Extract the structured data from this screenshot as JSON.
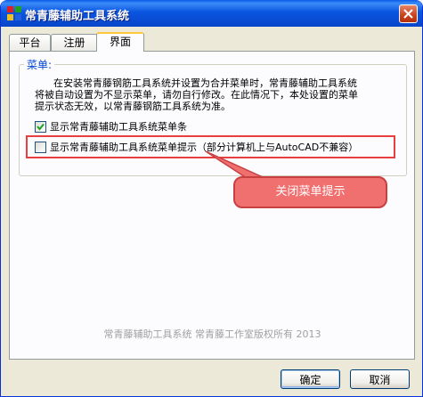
{
  "window": {
    "title": "常青藤辅助工具系统",
    "close_icon": "close-icon",
    "app_icon": "app-icon"
  },
  "tabs": [
    {
      "label": "平台",
      "active": false
    },
    {
      "label": "注册",
      "active": false
    },
    {
      "label": "界面",
      "active": true
    }
  ],
  "menu_group": {
    "legend": "菜单:",
    "description_lines": [
      "      在安装常青藤钢筋工具系统并设置为合并菜单时，常青藤辅助工具系统",
      "将被自动设置为不显示菜单，请勿自行修改。在此情况下，本处设置的菜单",
      "提示状态无效，以常青藤钢筋工具系统为准。"
    ],
    "checkboxes": [
      {
        "label": "显示常青藤辅助工具系统菜单条",
        "checked": true
      },
      {
        "label": "显示常青藤辅助工具系统菜单提示（部分计算机上与AutoCAD不兼容）",
        "checked": false
      }
    ]
  },
  "annotation": {
    "callout_text": "关闭菜单提示",
    "color": "#e84040"
  },
  "footer": {
    "copyright": "常青藤辅助工具系统  常青藤工作室版权所有  2013"
  },
  "buttons": {
    "ok_label": "确定",
    "cancel_label": "取消"
  },
  "colors": {
    "titlebar": "#0a55e0",
    "tab_highlight": "#ffc83c",
    "legend_text": "#0046d5"
  }
}
